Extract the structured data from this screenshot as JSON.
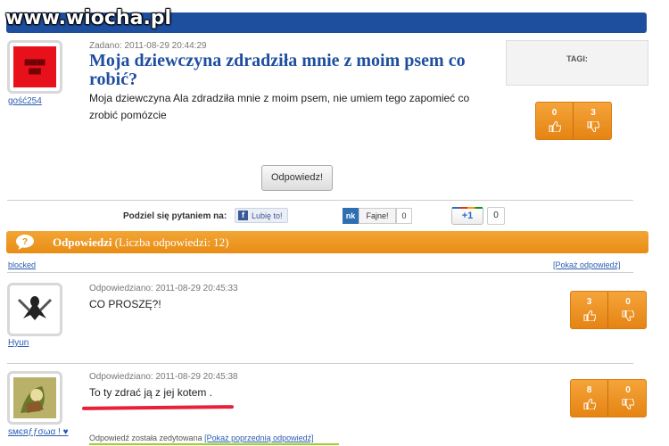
{
  "watermark": "www.wiocha.pl",
  "question": {
    "asked_label": "Zadano: 2011-08-29 20:44:29",
    "title": "Moja dziewczyna zdradziła mnie z moim psem co robić?",
    "body": "Moja dziewczyna Ala zdradziła mnie z moim psem, nie umiem tego zapomieć co zrobić pomózcie",
    "author": "gość254",
    "votes_up": "0",
    "votes_down": "3",
    "reply_button": "Odpowiedz!"
  },
  "tags": {
    "label": "TAGI:"
  },
  "share": {
    "label": "Podziel się pytaniem na:",
    "facebook": "Lubię to!",
    "nk_icon": "nk",
    "nk_label": "Fajne!",
    "nk_count": "0",
    "gplus_label": "+1",
    "gplus_count": "0"
  },
  "answers_header": {
    "title": "Odpowiedzi",
    "count_label": "(Liczba odpowiedzi: 12)"
  },
  "blocked_link": "blocked",
  "show_answer_link": "[Pokaż odpowiedź]",
  "answers": [
    {
      "meta": "Odpowiedziano: 2011-08-29 20:45:33",
      "text": "CO PROSZĘ?!",
      "author": "Hyun",
      "votes_up": "3",
      "votes_down": "0"
    },
    {
      "meta": "Odpowiedziano: 2011-08-29 20:45:38",
      "text": "To ty zdrać ją z jej kotem .",
      "author": "ѕмєяƒƒσωα ! ♥",
      "votes_up": "8",
      "votes_down": "0"
    }
  ],
  "edited_note": {
    "text": "Odpowiedź została zedytowana",
    "link": "[Pokaż poprzednią odpowiedź]"
  },
  "colors": {
    "blue_bar": "#1e4f9e",
    "orange": "#ef9a20",
    "link": "#2a5db0",
    "highlight": "#e8213a"
  }
}
